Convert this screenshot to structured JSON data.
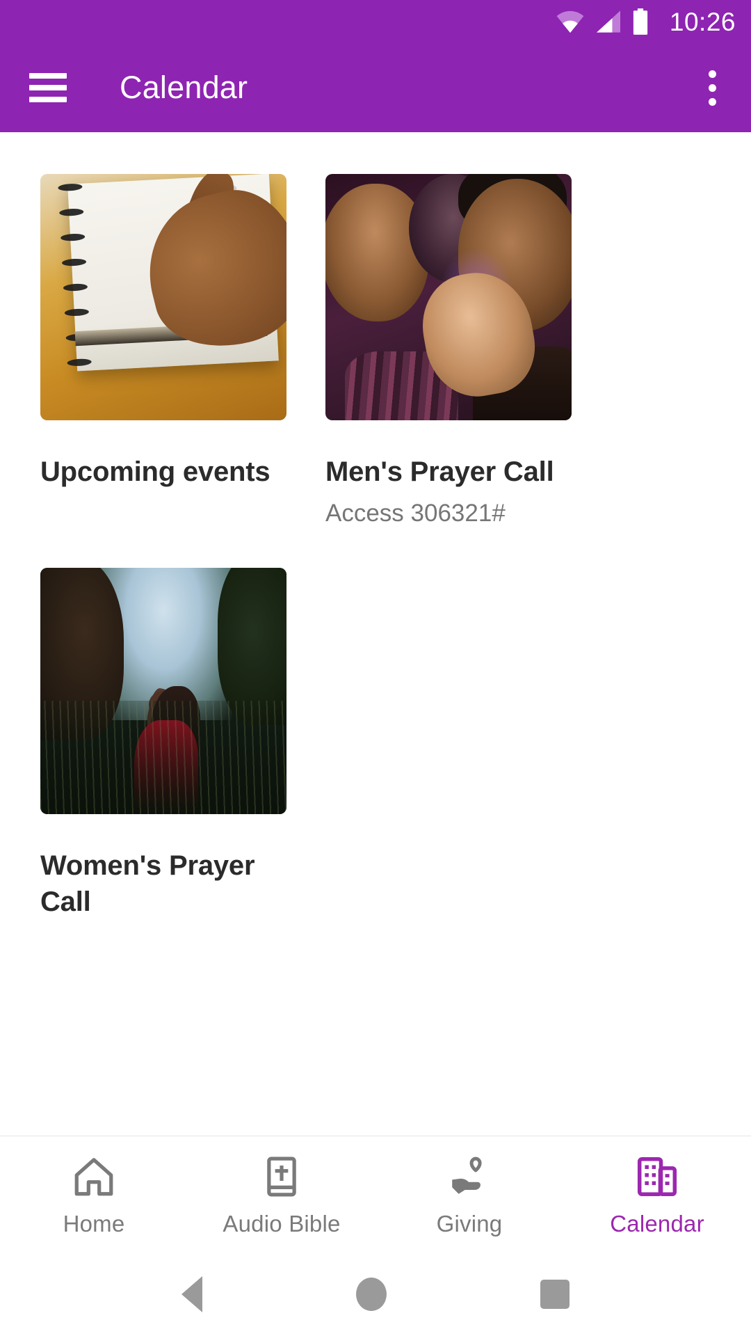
{
  "status_bar": {
    "time": "10:26",
    "icons": [
      "wifi-icon",
      "cellular-signal-icon",
      "battery-icon"
    ]
  },
  "app_bar": {
    "title": "Calendar",
    "menu_icon": "hamburger-menu-icon",
    "overflow_icon": "overflow-menu-icon",
    "background_color": "#8E24B2"
  },
  "cards": [
    {
      "title": "Upcoming events",
      "subtitle": "",
      "image_alt": "hand writing in a spiral notebook on a wooden table"
    },
    {
      "title": "Men's Prayer Call",
      "subtitle": "Access 306321#",
      "image_alt": "three men praying together with hands raised"
    },
    {
      "title": "Women's Prayer Call",
      "subtitle": "",
      "image_alt": "woman in a red dress praying in a field looking upward"
    }
  ],
  "tab_bar": {
    "items": [
      {
        "label": "Home",
        "icon": "home-icon",
        "active": false
      },
      {
        "label": "Audio Bible",
        "icon": "bible-book-icon",
        "active": false
      },
      {
        "label": "Giving",
        "icon": "hand-heart-icon",
        "active": false
      },
      {
        "label": "Calendar",
        "icon": "building-icon",
        "active": true
      }
    ],
    "active_color": "#9C27B0",
    "inactive_color": "#7A7A7A"
  },
  "android_nav": {
    "back": "back-triangle-icon",
    "home": "home-circle-icon",
    "recents": "recents-square-icon"
  }
}
